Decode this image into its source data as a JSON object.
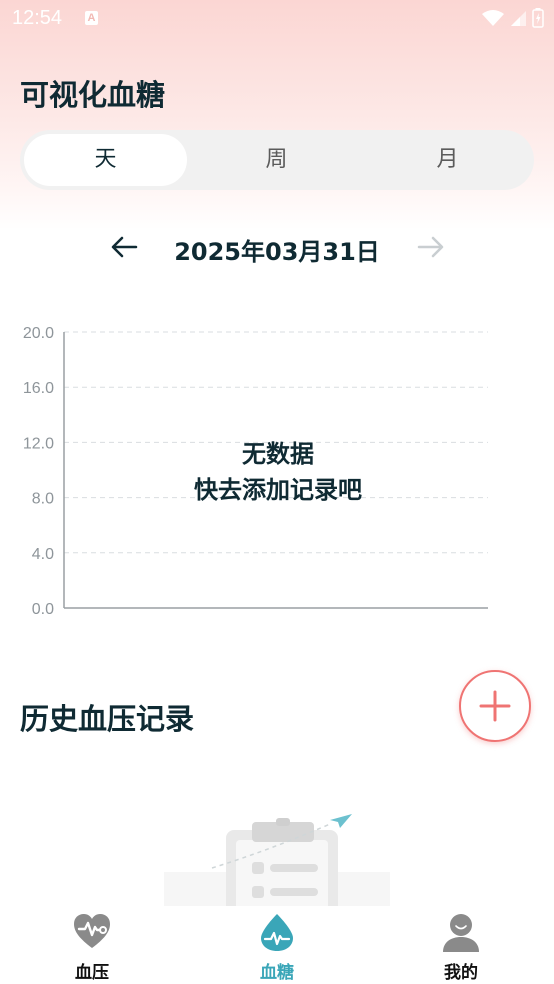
{
  "status_bar": {
    "time": "12:54",
    "notification_letter": "A"
  },
  "header": {
    "title": "可视化血糖"
  },
  "period_tabs": [
    {
      "label": "天",
      "active": true
    },
    {
      "label": "周",
      "active": false
    },
    {
      "label": "月",
      "active": false
    }
  ],
  "date_nav": {
    "date": "2025年03月31日",
    "prev_icon": "arrow-left-icon",
    "next_icon": "arrow-right-icon"
  },
  "chart_data": {
    "type": "line",
    "y_ticks": [
      "20.0",
      "16.0",
      "12.0",
      "8.0",
      "4.0",
      "0.0"
    ],
    "ylim": [
      0,
      20
    ],
    "series": [],
    "grid": true,
    "empty_message_line1": "无数据",
    "empty_message_line2": "快去添加记录吧"
  },
  "history": {
    "title": "历史血压记录",
    "add_icon": "plus-icon"
  },
  "bottom_nav": [
    {
      "label": "血压",
      "icon": "heart-pulse-icon",
      "active": false
    },
    {
      "label": "血糖",
      "icon": "blood-drop-icon",
      "active": true
    },
    {
      "label": "我的",
      "icon": "user-icon",
      "active": false
    }
  ],
  "colors": {
    "accent": "#3aa6b8",
    "fab": "#ef7473",
    "text": "#0f2a33"
  }
}
